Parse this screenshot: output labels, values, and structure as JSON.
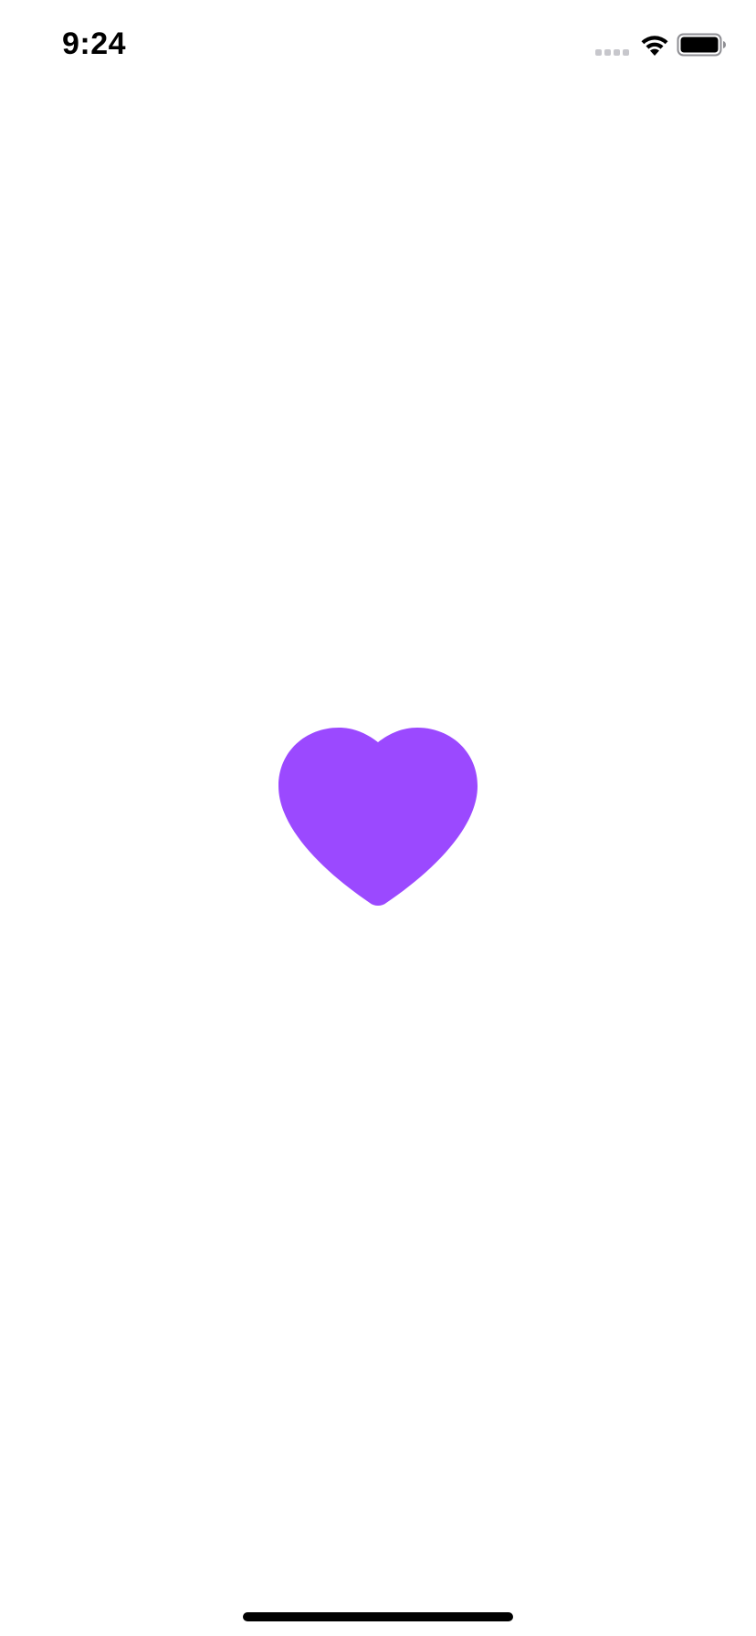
{
  "status_bar": {
    "time": "9:24",
    "signal_icon": "cellular-signal-no-service-icon",
    "wifi_icon": "wifi-icon",
    "battery_icon": "battery-full-icon"
  },
  "main": {
    "icon": "heart-icon",
    "heart_color": "#9b49ff"
  },
  "home_indicator": {
    "color": "#000000"
  }
}
